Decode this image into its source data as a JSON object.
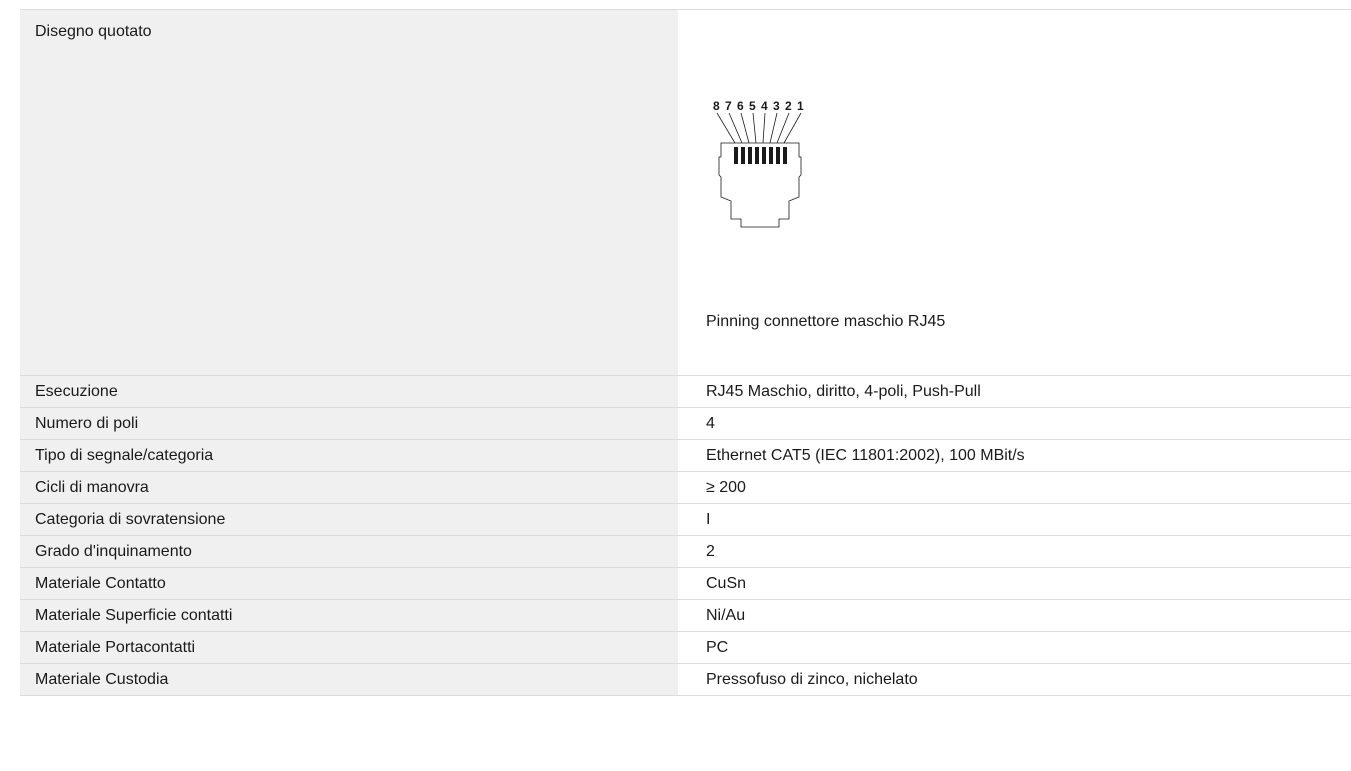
{
  "drawing": {
    "label": "Disegno quotato",
    "caption": "Pinning connettore maschio RJ45",
    "pin_numbers": [
      "8",
      "7",
      "6",
      "5",
      "4",
      "3",
      "2",
      "1"
    ]
  },
  "specs": [
    {
      "label": "Esecuzione",
      "value": "RJ45 Maschio, diritto, 4-poli, Push-Pull"
    },
    {
      "label": "Numero di poli",
      "value": "4"
    },
    {
      "label": "Tipo di segnale/categoria",
      "value": "Ethernet CAT5 (IEC 11801:2002), 100 MBit/s"
    },
    {
      "label": "Cicli di manovra",
      "value": "≥ 200"
    },
    {
      "label": "Categoria di sovratensione",
      "value": "I"
    },
    {
      "label": "Grado d'inquinamento",
      "value": "2"
    },
    {
      "label": "Materiale Contatto",
      "value": "CuSn"
    },
    {
      "label": "Materiale Superficie contatti",
      "value": "Ni/Au"
    },
    {
      "label": "Materiale Portacontatti",
      "value": "PC"
    },
    {
      "label": "Materiale Custodia",
      "value": "Pressofuso di zinco, nichelato"
    }
  ]
}
